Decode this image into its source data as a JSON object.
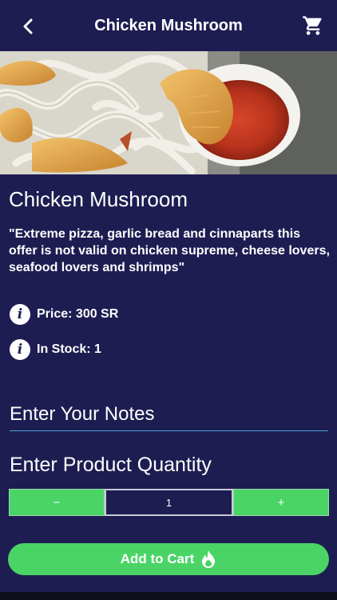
{
  "header": {
    "title": "Chicken Mushroom"
  },
  "product": {
    "name": "Chicken Mushroom",
    "description": "\"Extreme pizza, garlic bread and cinnaparts this offer is not valid on chicken supreme, cheese lovers, seafood lovers and shrimps\"",
    "price_text": "Price: 300 SR",
    "stock_text": "In Stock: 1"
  },
  "notes": {
    "placeholder": "Enter Your Notes",
    "value": ""
  },
  "quantity": {
    "label": "Enter Product Quantity",
    "minus": "−",
    "plus": "+",
    "value": "1"
  },
  "actions": {
    "add_to_cart": "Add to Cart"
  },
  "colors": {
    "background": "#1e1d52",
    "accent_green": "#4ad466",
    "underline_blue": "#4aa3d8"
  },
  "icons": {
    "back": "chevron-left-icon",
    "cart": "shopping-cart-icon",
    "info": "info-icon",
    "fire": "flame-icon"
  }
}
